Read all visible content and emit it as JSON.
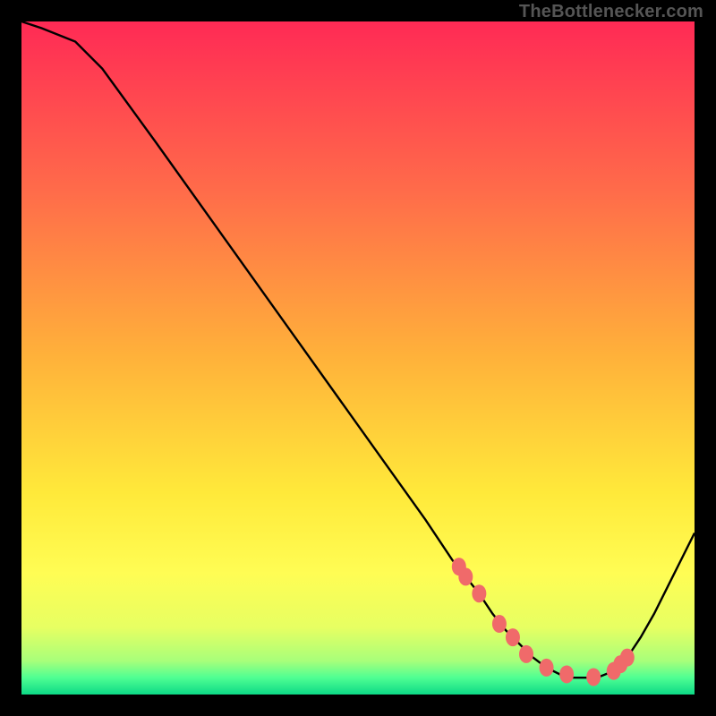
{
  "attribution": "TheBottlenecker.com",
  "chart_data": {
    "type": "line",
    "title": "",
    "xlabel": "",
    "ylabel": "",
    "xlim": [
      0,
      100
    ],
    "ylim": [
      0,
      100
    ],
    "x": [
      0,
      3,
      8,
      12,
      20,
      30,
      40,
      50,
      60,
      64,
      66,
      68,
      70,
      72,
      74,
      76,
      78,
      80,
      82,
      84,
      86,
      88,
      90,
      92,
      94,
      96,
      98,
      100
    ],
    "y": [
      100,
      99,
      97,
      93,
      82,
      68,
      54,
      40,
      26,
      20,
      17.5,
      15,
      12,
      9.5,
      7.5,
      5.5,
      4,
      3,
      2.5,
      2.5,
      2.7,
      3.5,
      5.5,
      8.5,
      12,
      16,
      20,
      24
    ],
    "marker_points": {
      "x": [
        65,
        66,
        68,
        71,
        73,
        75,
        78,
        81,
        85,
        88,
        89,
        90
      ],
      "y": [
        19,
        17.5,
        15,
        10.5,
        8.5,
        6,
        4,
        3,
        2.6,
        3.5,
        4.5,
        5.5
      ]
    },
    "background": {
      "type": "linear-gradient",
      "direction": "top-to-bottom",
      "stops": [
        {
          "offset": 0.0,
          "color": "#ff2a55"
        },
        {
          "offset": 0.25,
          "color": "#ff6b4a"
        },
        {
          "offset": 0.5,
          "color": "#ffb23a"
        },
        {
          "offset": 0.7,
          "color": "#ffe93a"
        },
        {
          "offset": 0.82,
          "color": "#fffd54"
        },
        {
          "offset": 0.9,
          "color": "#e7ff62"
        },
        {
          "offset": 0.95,
          "color": "#a8ff7a"
        },
        {
          "offset": 0.975,
          "color": "#4fff93"
        },
        {
          "offset": 1.0,
          "color": "#0dd986"
        }
      ]
    },
    "line_color": "#000000",
    "marker_color": "#f06a6a"
  }
}
